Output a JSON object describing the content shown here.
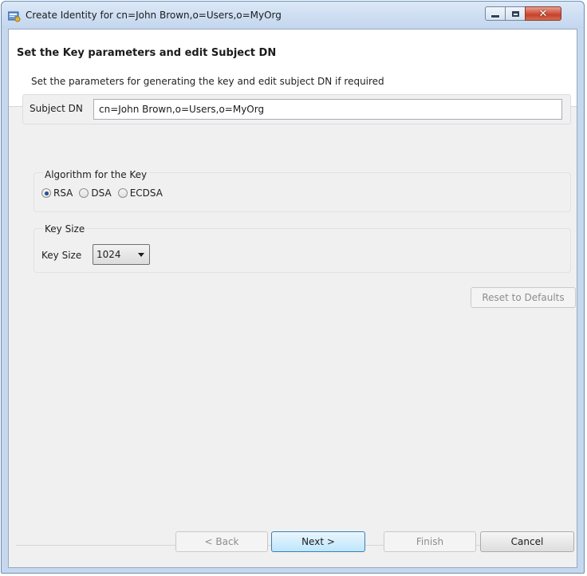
{
  "window": {
    "title": "Create Identity for cn=John Brown,o=Users,o=MyOrg",
    "close_glyph": "✕"
  },
  "header": {
    "title": "Set the Key parameters and edit Subject DN",
    "description": "Set the parameters for generating the key and edit subject DN if required"
  },
  "subject_dn": {
    "label": "Subject DN",
    "value": "cn=John Brown,o=Users,o=MyOrg"
  },
  "algorithm": {
    "legend": "Algorithm for the Key",
    "options": [
      {
        "label": "RSA",
        "selected": true
      },
      {
        "label": "DSA",
        "selected": false
      },
      {
        "label": "ECDSA",
        "selected": false
      }
    ]
  },
  "key_size": {
    "legend": "Key Size",
    "label": "Key Size",
    "selected": "1024"
  },
  "buttons": {
    "reset": "Reset to Defaults",
    "back": "< Back",
    "next": "Next >",
    "finish": "Finish",
    "cancel": "Cancel"
  },
  "colors": {
    "window_frame": "#c6d8ee",
    "dialog_bg": "#f0f0f0",
    "default_button_border": "#3c7fb1",
    "radio_selected": "#1c4f96"
  }
}
